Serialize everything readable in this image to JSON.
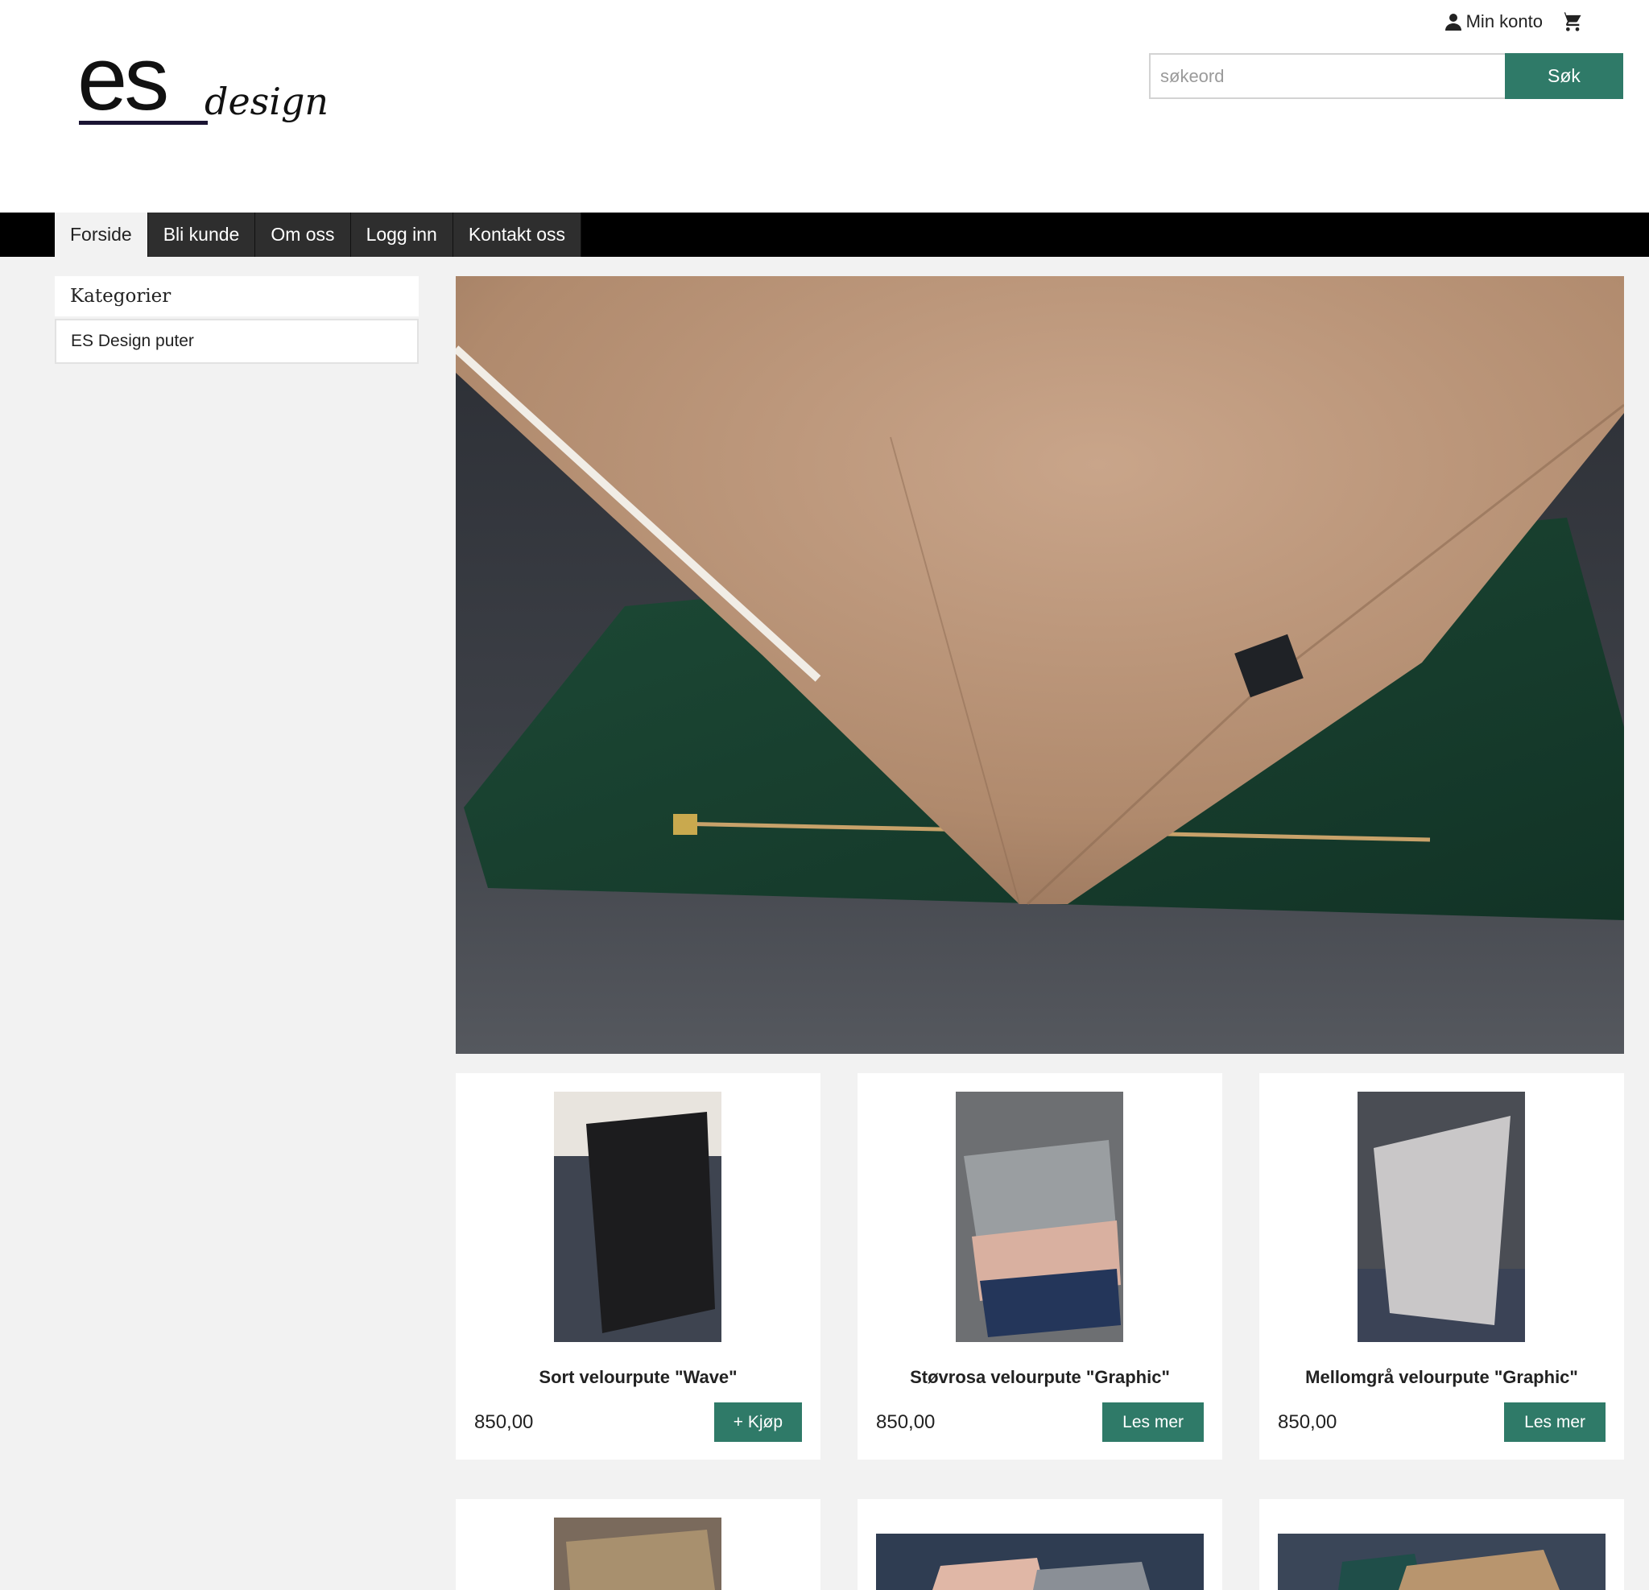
{
  "header": {
    "logo_text": "es design",
    "account_label": "Min konto",
    "search": {
      "placeholder": "søkeord",
      "button_label": "Søk"
    }
  },
  "nav": {
    "items": [
      {
        "label": "Forside",
        "active": true
      },
      {
        "label": "Bli kunde"
      },
      {
        "label": "Om oss"
      },
      {
        "label": "Logg inn"
      },
      {
        "label": "Kontakt oss"
      }
    ]
  },
  "sidebar": {
    "heading": "Kategorier",
    "items": [
      {
        "label": "ES Design puter"
      }
    ]
  },
  "products": [
    {
      "name": "Sort velourpute \"Wave\"",
      "price": "850,00",
      "button_label": "+ Kjøp"
    },
    {
      "name": "Støvrosa velourpute \"Graphic\"",
      "price": "850,00",
      "button_label": "Les mer"
    },
    {
      "name": "Mellomgrå velourpute \"Graphic\"",
      "price": "850,00",
      "button_label": "Les mer"
    }
  ],
  "colors": {
    "accent": "#2f7a68",
    "nav_background": "#000000",
    "page_background": "#f2f2f2"
  }
}
